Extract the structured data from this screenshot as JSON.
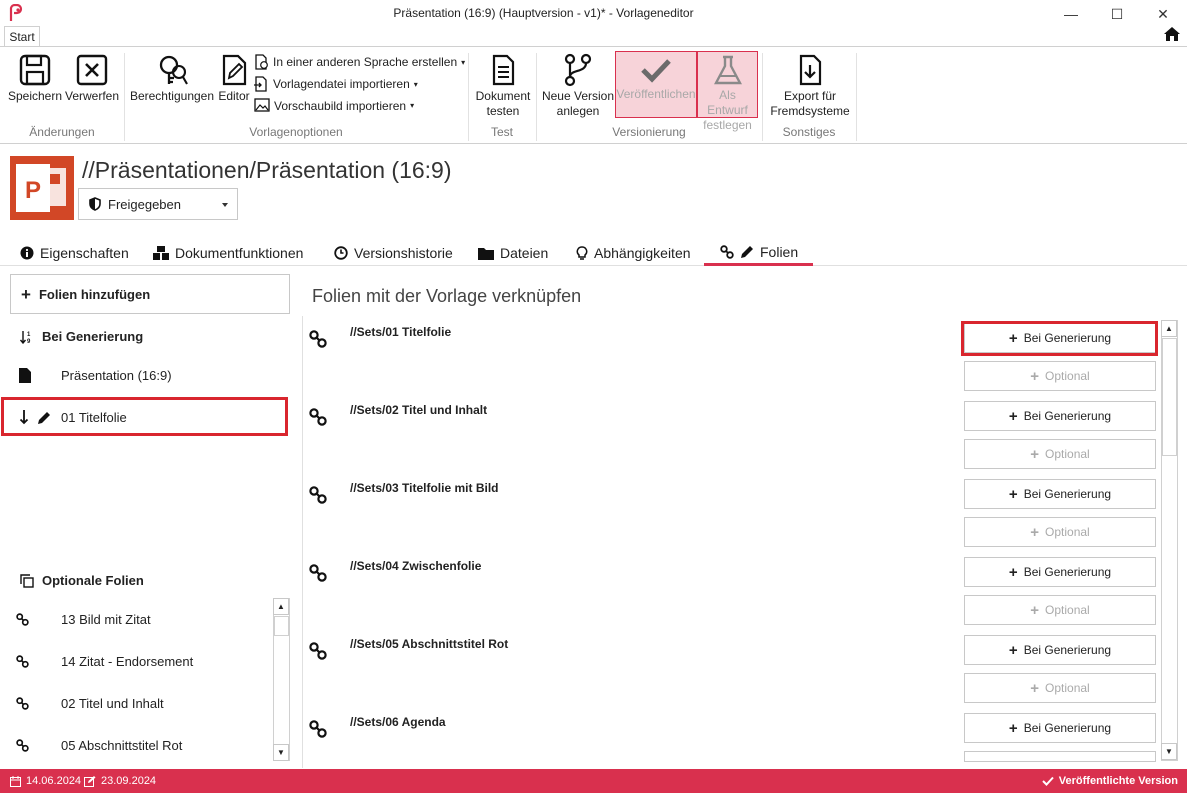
{
  "window": {
    "title": "Präsentation (16:9) (Hauptversion - v1)* - Vorlageneditor",
    "minimize": "—",
    "maximize": "☐",
    "close": "✕"
  },
  "ribbon": {
    "tab": "Start",
    "groups": {
      "aenderungen": "Änderungen",
      "vorlagenoptionen": "Vorlagenoptionen",
      "test": "Test",
      "versionierung": "Versionierung",
      "sonstiges": "Sonstiges"
    },
    "buttons": {
      "speichern": "Speichern",
      "verwerfen": "Verwerfen",
      "berechtigungen": "Berechtigungen",
      "editor": "Editor",
      "sprache": "In einer anderen Sprache erstellen",
      "vorlagendatei": "Vorlagendatei importieren",
      "vorschaubild": "Vorschaubild importieren",
      "dokument_testen_1": "Dokument",
      "dokument_testen_2": "testen",
      "neue_version_1": "Neue Version",
      "neue_version_2": "anlegen",
      "veroeffentlichen": "Veröffentlichen",
      "entwurf_1": "Als Entwurf",
      "entwurf_2": "festlegen",
      "export_1": "Export für",
      "export_2": "Fremdsysteme"
    }
  },
  "header": {
    "title": "//Präsentationen/Präsentation (16:9)",
    "status": "Freigegeben"
  },
  "tabs": [
    {
      "label": "Eigenschaften",
      "icon": "info-icon"
    },
    {
      "label": "Dokumentfunktionen",
      "icon": "cubes-icon"
    },
    {
      "label": "Versionshistorie",
      "icon": "clock-icon"
    },
    {
      "label": "Dateien",
      "icon": "folder-icon"
    },
    {
      "label": "Abhängigkeiten",
      "icon": "lightbulb-icon"
    },
    {
      "label": "Folien",
      "icon": "link-pencil-icon",
      "active": true
    }
  ],
  "left_panel": {
    "add_button": "Folien hinzufügen",
    "generation_heading": "Bei Generierung",
    "generation_items": [
      "Präsentation (16:9)",
      "01 Titelfolie"
    ],
    "optional_heading": "Optionale Folien",
    "optional_items": [
      "13 Bild mit Zitat",
      "14 Zitat - Endorsement",
      "02 Titel und Inhalt",
      "05 Abschnittstitel Rot"
    ]
  },
  "right_panel": {
    "heading": "Folien mit der Vorlage verknüpfen",
    "generation_label": "Bei Generierung",
    "optional_label": "Optional",
    "slides": [
      "//Sets/01 Titelfolie",
      "//Sets/02 Titel und Inhalt",
      "//Sets/03 Titelfolie mit Bild",
      "//Sets/04 Zwischenfolie",
      "//Sets/05 Abschnittstitel Rot",
      "//Sets/06 Agenda"
    ]
  },
  "statusbar": {
    "created": "14.06.2024",
    "modified": "23.09.2024",
    "version_state": "Veröffentlichte Version"
  },
  "colors": {
    "accent": "#d9304e",
    "highlight": "#d9262e",
    "ppt_orange": "#d24726"
  }
}
